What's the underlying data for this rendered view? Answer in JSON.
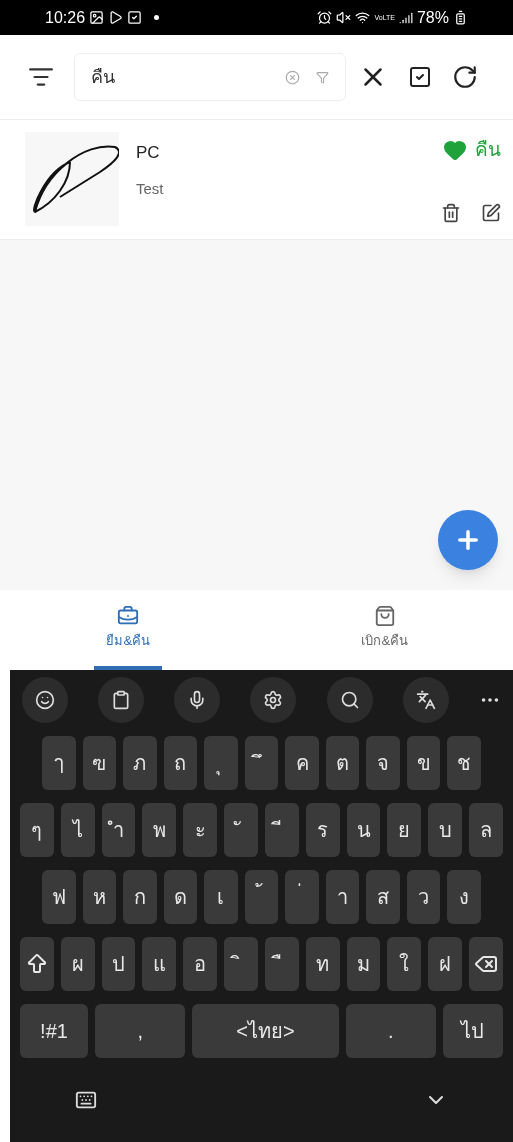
{
  "status_bar": {
    "time": "10:26",
    "network": "VoLTE",
    "battery": "78%"
  },
  "search": {
    "value": "คืน"
  },
  "items": [
    {
      "title": "PC",
      "subtitle": "Test",
      "status": "คืน",
      "favorite": true
    }
  ],
  "nav_tabs": [
    {
      "label": "ยืม&คืน",
      "selected": true
    },
    {
      "label": "เบิก&คืน",
      "selected": false
    }
  ],
  "keyboard": {
    "rows": [
      [
        {
          "label": "ๅ"
        },
        {
          "label": "ฃ"
        },
        {
          "label": "ภ"
        },
        {
          "label": "ถ"
        },
        {
          "label": "ุ"
        },
        {
          "label": "ึ"
        },
        {
          "label": "ค"
        },
        {
          "label": "ต"
        },
        {
          "label": "จ"
        },
        {
          "label": "ข"
        },
        {
          "label": "ช"
        }
      ],
      [
        {
          "label": "ๆ"
        },
        {
          "label": "ไ"
        },
        {
          "label": "ำ"
        },
        {
          "label": "พ"
        },
        {
          "label": "ะ"
        },
        {
          "label": "ั"
        },
        {
          "label": "ี"
        },
        {
          "label": "ร"
        },
        {
          "label": "น"
        },
        {
          "label": "ย"
        },
        {
          "label": "บ"
        },
        {
          "label": "ล"
        }
      ],
      [
        {
          "label": "ฟ"
        },
        {
          "label": "ห"
        },
        {
          "label": "ก"
        },
        {
          "label": "ด"
        },
        {
          "label": "เ"
        },
        {
          "label": "้"
        },
        {
          "label": "่"
        },
        {
          "label": "า"
        },
        {
          "label": "ส"
        },
        {
          "label": "ว"
        },
        {
          "label": "ง"
        }
      ],
      [
        {
          "kind": "shift"
        },
        {
          "label": "ผ"
        },
        {
          "label": "ป"
        },
        {
          "label": "แ"
        },
        {
          "label": "อ"
        },
        {
          "label": "ิ"
        },
        {
          "label": "ื"
        },
        {
          "label": "ท"
        },
        {
          "label": "ม"
        },
        {
          "label": "ใ"
        },
        {
          "label": "ฝ"
        },
        {
          "kind": "backspace"
        }
      ],
      [
        {
          "kind": "symbols",
          "label": "!#1"
        },
        {
          "label": ","
        },
        {
          "kind": "space",
          "label": "ไทย",
          "left": "<",
          "right": ">"
        },
        {
          "label": "."
        },
        {
          "kind": "enter",
          "label": "ไป"
        }
      ]
    ]
  }
}
